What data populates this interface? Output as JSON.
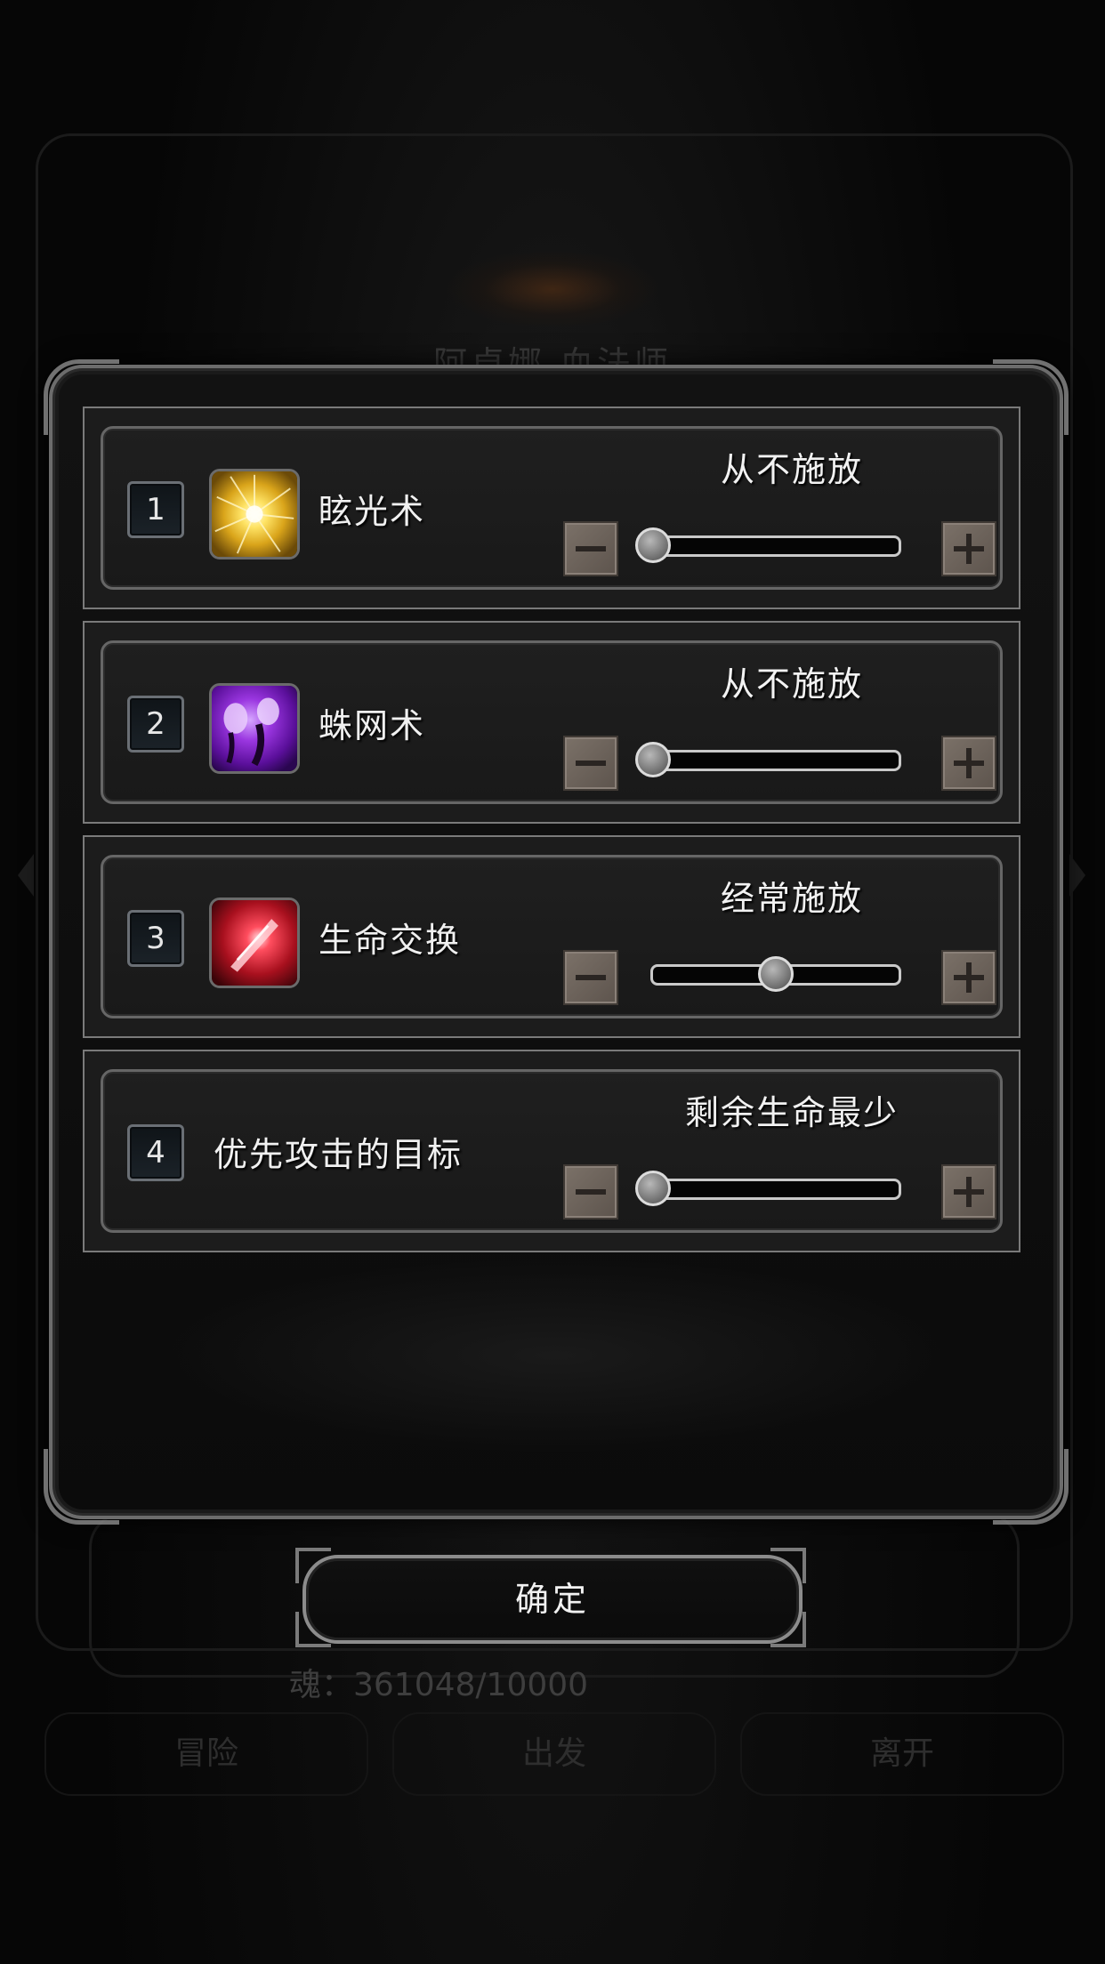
{
  "background": {
    "title": "阿卓娜 血法师",
    "soul_text": "魂：361048/10000",
    "buttons": [
      "冒险",
      "出发",
      "离开"
    ]
  },
  "dialog": {
    "rows": [
      {
        "number": "1",
        "name": "眩光术",
        "level": "从不施放",
        "level_fraction": 0.0,
        "icon": "glare-burst-icon"
      },
      {
        "number": "2",
        "name": "蛛网术",
        "level": "从不施放",
        "level_fraction": 0.0,
        "icon": "web-spell-icon"
      },
      {
        "number": "3",
        "name": "生命交换",
        "level": "经常施放",
        "level_fraction": 0.5,
        "icon": "life-exchange-icon"
      },
      {
        "number": "4",
        "name": "优先攻击的目标",
        "level": "剩余生命最少",
        "level_fraction": 0.0,
        "icon": ""
      }
    ],
    "minus_icon": "minus-icon",
    "plus_icon": "plus-icon"
  },
  "confirm_label": "确定",
  "colors": {
    "row_bg": "#1c1c1c",
    "border": "#7a7a7a",
    "step_button": "#6e655d",
    "glare_yellow": "#f2d23a",
    "web_purple": "#8a2ad0",
    "life_red": "#e0283a"
  }
}
